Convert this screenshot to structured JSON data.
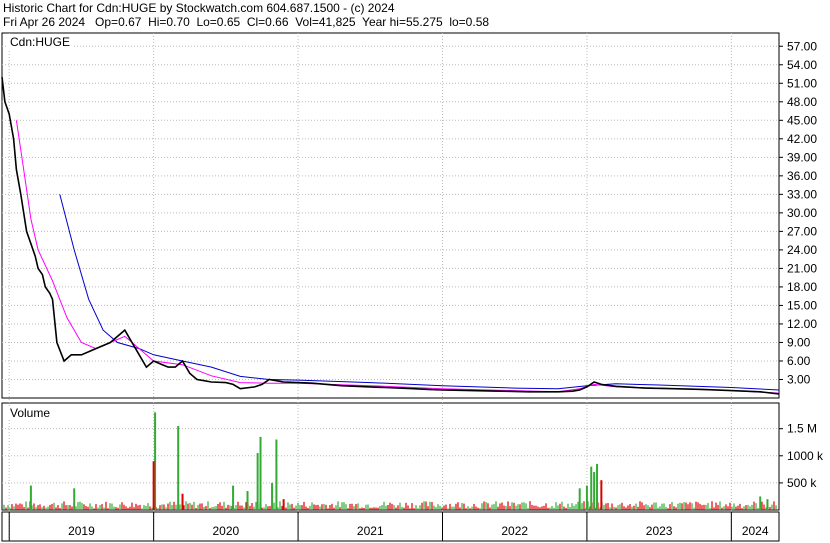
{
  "header": {
    "line1": "Historic Chart for Cdn:HUGE by Stockwatch.com 604.687.1500 - (c) 2024",
    "line2": "Fri Apr 26 2024   Op=0.67  Hi=0.70  Lo=0.65  Cl=0.66  Vol=41,825  Year hi=55.275  lo=0.58"
  },
  "colors": {
    "price": "#000000",
    "ma_short": "#ff00ff",
    "ma_long": "#0000cc",
    "volume_up": "#33aa33",
    "volume_down": "#dd0000",
    "grid": "#bbbbbb",
    "axis": "#000000"
  },
  "chart_data": [
    {
      "type": "line",
      "name": "price-panel",
      "title": "Cdn:HUGE",
      "ylim": [
        0,
        58.5
      ],
      "y_ticks": [
        "3.00",
        "6.00",
        "9.00",
        "12.00",
        "15.00",
        "18.00",
        "21.00",
        "24.00",
        "27.00",
        "30.00",
        "33.00",
        "36.00",
        "39.00",
        "42.00",
        "45.00",
        "48.00",
        "51.00",
        "54.00",
        "57.00"
      ],
      "x_labels": [
        "2019",
        "2020",
        "2021",
        "2022",
        "2023",
        "2024"
      ],
      "x_range": [
        2018.95,
        2024.33
      ],
      "grid": true,
      "series": [
        {
          "role": "price",
          "x": [
            2018.95,
            2018.97,
            2019.0,
            2019.03,
            2019.05,
            2019.08,
            2019.1,
            2019.12,
            2019.15,
            2019.18,
            2019.2,
            2019.23,
            2019.25,
            2019.28,
            2019.3,
            2019.33,
            2019.38,
            2019.43,
            2019.5,
            2019.6,
            2019.7,
            2019.8,
            2019.85,
            2019.9,
            2019.95,
            2020.0,
            2020.05,
            2020.1,
            2020.15,
            2020.2,
            2020.25,
            2020.3,
            2020.35,
            2020.4,
            2020.5,
            2020.55,
            2020.6,
            2020.7,
            2020.75,
            2020.8,
            2020.85,
            2020.9,
            2021.0,
            2021.1,
            2021.2,
            2021.3,
            2021.4,
            2021.5,
            2021.6,
            2021.7,
            2021.8,
            2021.9,
            2022.0,
            2022.2,
            2022.4,
            2022.6,
            2022.8,
            2022.9,
            2022.95,
            2023.0,
            2023.05,
            2023.1,
            2023.2,
            2023.4,
            2023.6,
            2023.8,
            2024.0,
            2024.2,
            2024.33
          ],
          "values": [
            52,
            48,
            46,
            42,
            37,
            33,
            30,
            27,
            25,
            23,
            21,
            20,
            18,
            17,
            16,
            9,
            6,
            7,
            7,
            8,
            9,
            11,
            9,
            7,
            5,
            6,
            5.5,
            5,
            5,
            6,
            4,
            3,
            2.8,
            2.6,
            2.5,
            2.2,
            1.5,
            1.8,
            2.2,
            3,
            2.8,
            2.6,
            2.5,
            2.4,
            2.2,
            2.0,
            1.9,
            1.8,
            1.7,
            1.6,
            1.5,
            1.4,
            1.3,
            1.2,
            1.1,
            1.0,
            1.0,
            1.1,
            1.3,
            1.8,
            2.6,
            2.2,
            1.9,
            1.6,
            1.5,
            1.4,
            1.2,
            1.0,
            0.66
          ]
        },
        {
          "role": "ma_short",
          "x": [
            2019.05,
            2019.1,
            2019.15,
            2019.2,
            2019.3,
            2019.4,
            2019.5,
            2019.6,
            2019.7,
            2019.8,
            2019.9,
            2020.0,
            2020.2,
            2020.4,
            2020.6,
            2020.8,
            2021.0,
            2021.5,
            2022.0,
            2022.5,
            2022.8,
            2022.95,
            2023.05,
            2023.2,
            2023.5,
            2024.0,
            2024.33
          ],
          "values": [
            45,
            37,
            29,
            24,
            19,
            13,
            9,
            8,
            9,
            10,
            8,
            6,
            5.4,
            3.6,
            2.5,
            2.4,
            2.4,
            2.0,
            1.5,
            1.2,
            1.0,
            1.5,
            2.2,
            1.8,
            1.6,
            1.2,
            0.8
          ]
        },
        {
          "role": "ma_long",
          "x": [
            2019.35,
            2019.45,
            2019.55,
            2019.65,
            2019.75,
            2019.9,
            2020.0,
            2020.2,
            2020.4,
            2020.6,
            2020.8,
            2021.0,
            2021.5,
            2022.0,
            2022.5,
            2022.8,
            2023.0,
            2023.2,
            2023.5,
            2024.0,
            2024.33
          ],
          "values": [
            33,
            24,
            16,
            11,
            9,
            8,
            7,
            6,
            5,
            3.5,
            3,
            2.9,
            2.5,
            2.0,
            1.6,
            1.5,
            2.0,
            2.3,
            2.1,
            1.7,
            1.3
          ]
        }
      ]
    },
    {
      "type": "bar",
      "name": "volume-panel",
      "title": "Volume",
      "y_ticks": [
        "500 k",
        "1000 k",
        "1.5 M"
      ],
      "ylim": [
        0,
        1900000
      ],
      "x_range": [
        2018.95,
        2024.33
      ],
      "spikes": [
        {
          "x": 2019.15,
          "value": 450000,
          "dir": "up"
        },
        {
          "x": 2019.45,
          "value": 400000,
          "dir": "up"
        },
        {
          "x": 2020.01,
          "value": 1800000,
          "dir": "up"
        },
        {
          "x": 2020.0,
          "value": 900000,
          "dir": "down"
        },
        {
          "x": 2020.17,
          "value": 1550000,
          "dir": "up"
        },
        {
          "x": 2020.2,
          "value": 300000,
          "dir": "down"
        },
        {
          "x": 2020.55,
          "value": 450000,
          "dir": "up"
        },
        {
          "x": 2020.65,
          "value": 350000,
          "dir": "up"
        },
        {
          "x": 2020.72,
          "value": 1050000,
          "dir": "up"
        },
        {
          "x": 2020.74,
          "value": 1350000,
          "dir": "up"
        },
        {
          "x": 2020.82,
          "value": 500000,
          "dir": "up"
        },
        {
          "x": 2020.85,
          "value": 1300000,
          "dir": "up"
        },
        {
          "x": 2020.9,
          "value": 200000,
          "dir": "down"
        },
        {
          "x": 2022.95,
          "value": 400000,
          "dir": "up"
        },
        {
          "x": 2023.0,
          "value": 450000,
          "dir": "up"
        },
        {
          "x": 2023.03,
          "value": 800000,
          "dir": "up"
        },
        {
          "x": 2023.05,
          "value": 700000,
          "dir": "up"
        },
        {
          "x": 2023.07,
          "value": 850000,
          "dir": "up"
        },
        {
          "x": 2023.1,
          "value": 550000,
          "dir": "down"
        },
        {
          "x": 2024.2,
          "value": 250000,
          "dir": "up"
        },
        {
          "x": 2024.25,
          "value": 200000,
          "dir": "up"
        }
      ],
      "baseline": 150000
    }
  ]
}
